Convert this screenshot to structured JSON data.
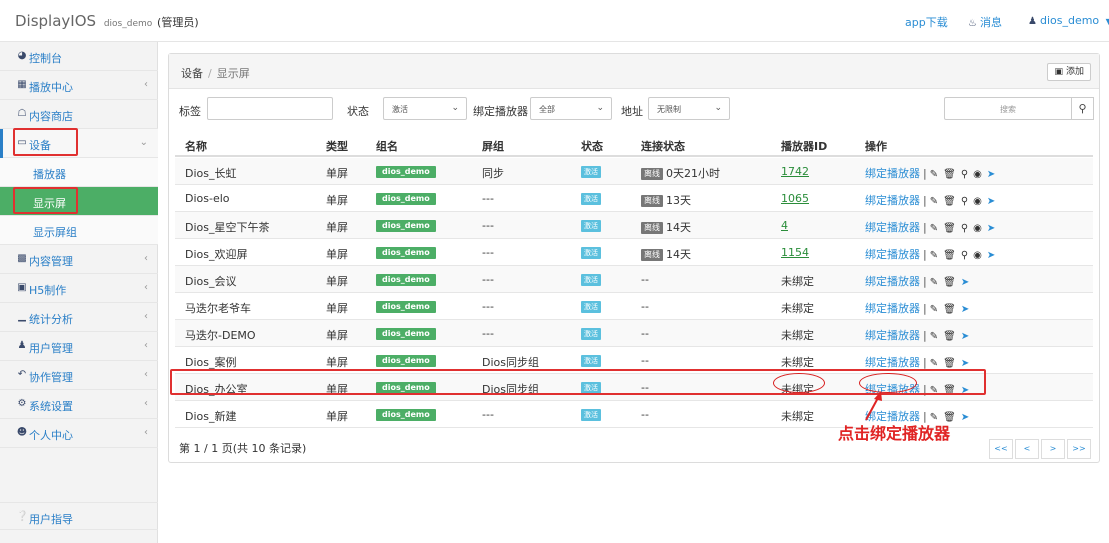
{
  "header": {
    "app_name": "DisplayIOS",
    "username_small": "dios_demo",
    "role": "(管理员)",
    "app_download": "app下载",
    "messages": "消息",
    "user_menu": "dios_demo"
  },
  "sidebar": {
    "items": [
      {
        "label": "控制台",
        "icon": "dashboard-icon"
      },
      {
        "label": "播放中心",
        "icon": "grid-icon"
      },
      {
        "label": "内容商店",
        "icon": "store-icon"
      },
      {
        "label": "设备",
        "icon": "monitor-icon"
      },
      {
        "label": "播放器",
        "icon": ""
      },
      {
        "label": "显示屏",
        "icon": ""
      },
      {
        "label": "显示屏组",
        "icon": ""
      },
      {
        "label": "内容管理",
        "icon": "content-icon"
      },
      {
        "label": "H5制作",
        "icon": "h5-icon"
      },
      {
        "label": "统计分析",
        "icon": "chart-icon"
      },
      {
        "label": "用户管理",
        "icon": "users-icon"
      },
      {
        "label": "协作管理",
        "icon": "collab-icon"
      },
      {
        "label": "系统设置",
        "icon": "gear-icon"
      },
      {
        "label": "个人中心",
        "icon": "person-icon"
      }
    ],
    "help": "用户指导"
  },
  "breadcrumb": {
    "root": "设备",
    "separator": "/",
    "current": "显示屏"
  },
  "add_button": "添加",
  "filters": {
    "tag_label": "标签",
    "status_label": "状态",
    "status_value": "激活",
    "player_label": "绑定播放器",
    "player_value": "全部",
    "address_label": "地址",
    "address_value": "无限制",
    "search_placeholder": "搜索"
  },
  "table": {
    "headers": [
      "名称",
      "类型",
      "组名",
      "屏组",
      "状态",
      "连接状态",
      "播放器ID",
      "操作"
    ],
    "rows": [
      {
        "name": "Dios_长虹",
        "type": "单屏",
        "group": "dios_demo",
        "screen_group": "同步",
        "status": "激活",
        "conn_badge": "离线",
        "conn_text": "0天21小时",
        "player_id": "1742",
        "bound": true
      },
      {
        "name": "Dios-elo",
        "type": "单屏",
        "group": "dios_demo",
        "screen_group": "---",
        "status": "激活",
        "conn_badge": "离线",
        "conn_text": "13天",
        "player_id": "1065",
        "bound": true
      },
      {
        "name": "Dios_星空下午茶",
        "type": "单屏",
        "group": "dios_demo",
        "screen_group": "---",
        "status": "激活",
        "conn_badge": "离线",
        "conn_text": "14天",
        "player_id": "4",
        "bound": true
      },
      {
        "name": "Dios_欢迎屏",
        "type": "单屏",
        "group": "dios_demo",
        "screen_group": "---",
        "status": "激活",
        "conn_badge": "离线",
        "conn_text": "14天",
        "player_id": "1154",
        "bound": true
      },
      {
        "name": "Dios_会议",
        "type": "单屏",
        "group": "dios_demo",
        "screen_group": "---",
        "status": "激活",
        "conn_badge": "",
        "conn_text": "--",
        "player_id": "未绑定",
        "bound": false
      },
      {
        "name": "马迭尔老爷车",
        "type": "单屏",
        "group": "dios_demo",
        "screen_group": "---",
        "status": "激活",
        "conn_badge": "",
        "conn_text": "--",
        "player_id": "未绑定",
        "bound": false
      },
      {
        "name": "马迭尔-DEMO",
        "type": "单屏",
        "group": "dios_demo",
        "screen_group": "---",
        "status": "激活",
        "conn_badge": "",
        "conn_text": "--",
        "player_id": "未绑定",
        "bound": false
      },
      {
        "name": "Dios_案例",
        "type": "单屏",
        "group": "dios_demo",
        "screen_group": "Dios同步组",
        "status": "激活",
        "conn_badge": "",
        "conn_text": "--",
        "player_id": "未绑定",
        "bound": false
      },
      {
        "name": "Dios_办公室",
        "type": "单屏",
        "group": "dios_demo",
        "screen_group": "Dios同步组",
        "status": "激活",
        "conn_badge": "",
        "conn_text": "--",
        "player_id": "未绑定",
        "bound": false
      },
      {
        "name": "Dios_新建",
        "type": "单屏",
        "group": "dios_demo",
        "screen_group": "---",
        "status": "激活",
        "conn_badge": "",
        "conn_text": "--",
        "player_id": "未绑定",
        "bound": false
      }
    ],
    "op_bind_label": "绑定播放器",
    "op_separator": "|"
  },
  "pagination": {
    "info": "第 1 / 1 页(共 10 条记录)",
    "buttons": [
      "<<",
      "<",
      ">",
      ">>"
    ]
  },
  "annotation": {
    "text": "点击绑定播放器"
  },
  "colors": {
    "accent": "#2a8dd4",
    "active_menu": "#4cae66",
    "annotation": "#e03030"
  }
}
